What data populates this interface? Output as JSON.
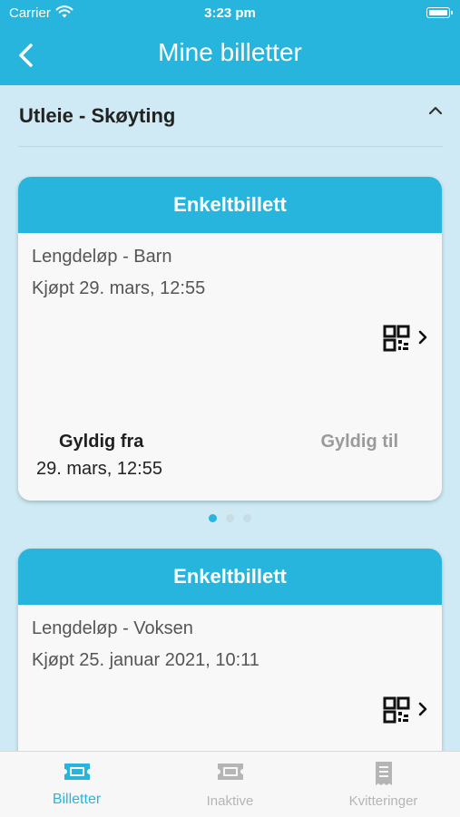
{
  "status_bar": {
    "carrier": "Carrier",
    "time": "3:23 pm"
  },
  "header": {
    "title": "Mine billetter",
    "back_icon": "chevron-left-icon"
  },
  "section": {
    "title": "Utleie - Skøyting",
    "toggle_icon": "chevron-up-icon"
  },
  "tickets": [
    {
      "type": "Enkeltbillett",
      "name": "Lengdeløp - Barn",
      "purchased": "Kjøpt 29. mars, 12:55",
      "valid_from_label": "Gyldig fra",
      "valid_from": "29. mars, 12:55",
      "valid_to_label": "Gyldig til"
    },
    {
      "type": "Enkeltbillett",
      "name": "Lengdeløp - Voksen",
      "purchased": "Kjøpt 25. januar 2021, 10:11"
    }
  ],
  "pager": {
    "pages": 3,
    "active": 1
  },
  "tabs": [
    {
      "label": "Billetter",
      "icon": "ticket-icon",
      "active": true
    },
    {
      "label": "Inaktive",
      "icon": "ticket-icon",
      "active": false
    },
    {
      "label": "Kvitteringer",
      "icon": "receipt-icon",
      "active": false
    }
  ],
  "colors": {
    "accent": "#27b5de",
    "background": "#cfeaf4",
    "inactive": "#b5b5b5"
  }
}
